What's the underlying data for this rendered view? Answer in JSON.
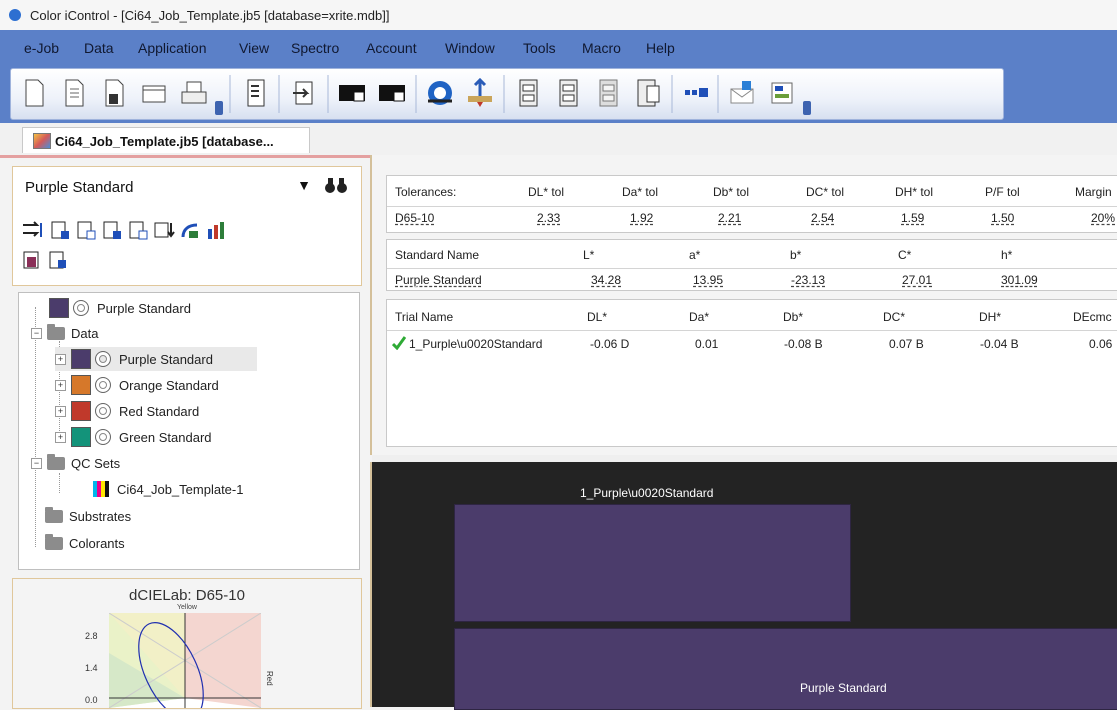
{
  "window": {
    "title": "Color iControl - [Ci64_Job_Template.jb5 [database=xrite.mdb]]"
  },
  "menu": [
    "e-Job",
    "Data",
    "Application",
    "View",
    "Spectro",
    "Account",
    "Window",
    "Tools",
    "Macro",
    "Help"
  ],
  "toolbar": {
    "icons": [
      "new-document-icon",
      "document-icon",
      "save-icon",
      "open-folder-icon",
      "print-icon",
      "report-icon",
      "export-icon",
      "black-white-icon",
      "black-white-alt-icon",
      "calibrate-icon",
      "measure-icon",
      "cabinet-icon",
      "cabinet-alt-icon",
      "cabinet-gray-icon",
      "cabinet-sheet-icon",
      "swatches-icon",
      "mail-icon",
      "preferences-icon"
    ]
  },
  "tab": {
    "label": "Ci64_Job_Template.jb5 [database..."
  },
  "standard_select": {
    "value": "Purple Standard"
  },
  "tree": {
    "top_item": "Purple Standard",
    "data_label": "Data",
    "data_items": [
      {
        "label": "Purple Standard",
        "color": "#4b3c6b"
      },
      {
        "label": "Orange Standard",
        "color": "#d6782a"
      },
      {
        "label": "Red Standard",
        "color": "#c0392b"
      },
      {
        "label": "Green Standard",
        "color": "#13937a"
      }
    ],
    "qc_sets_label": "QC Sets",
    "qc_item": "Ci64_Job_Template-1",
    "substrates_label": "Substrates",
    "colorants_label": "Colorants"
  },
  "plot": {
    "title": "dCIELab: D65-10",
    "top_axis": "Yellow",
    "right_axis": "Red",
    "ticks": [
      "2.8",
      "1.4",
      "0.0"
    ]
  },
  "tolerances": {
    "headers": [
      "Tolerances:",
      "DL* tol",
      "Da* tol",
      "Db* tol",
      "DC* tol",
      "DH* tol",
      "P/F tol",
      "Margin"
    ],
    "row": [
      "D65-10",
      "2.33",
      "1.92",
      "2.21",
      "2.54",
      "1.59",
      "1.50",
      "20%"
    ]
  },
  "standard_table": {
    "headers": [
      "Standard Name",
      "L*",
      "a*",
      "b*",
      "C*",
      "h*"
    ],
    "row": [
      "Purple Standard",
      "34.28",
      "13.95",
      "-23.13",
      "27.01",
      "301.09"
    ]
  },
  "trial_table": {
    "headers": [
      "Trial Name",
      "DL*",
      "Da*",
      "Db*",
      "DC*",
      "DH*",
      "DEcmc"
    ],
    "row": [
      "1_Purple\\u0020Standard",
      "-0.06 D",
      "0.01",
      "-0.08 B",
      "0.07 B",
      "-0.04 B",
      "0.06"
    ],
    "status": "pass"
  },
  "canvas": {
    "trial_label": "1_Purple\\u0020Standard",
    "standard_label": "Purple Standard",
    "swatch_color": "#4b3c6b"
  }
}
